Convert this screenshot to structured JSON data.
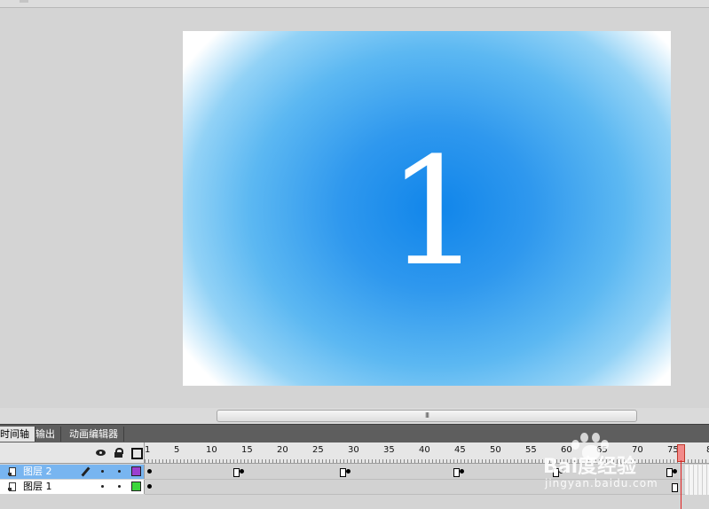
{
  "stage": {
    "content": "1"
  },
  "panel": {
    "tabs": [
      {
        "label": "时间轴",
        "active": true
      },
      {
        "label": "输出",
        "active": false
      },
      {
        "label": "动画编辑器",
        "active": false
      }
    ]
  },
  "timeline": {
    "ruler": [
      "1",
      "5",
      "10",
      "15",
      "20",
      "25",
      "30",
      "35",
      "40",
      "45",
      "50",
      "55",
      "60",
      "65",
      "70",
      "75",
      "8"
    ],
    "current_frame": 75,
    "layers": [
      {
        "name": "图层 2",
        "selected": true,
        "color": "#9b3fd0",
        "keyframes": [
          1,
          14,
          29,
          45,
          59,
          75
        ]
      },
      {
        "name": "图层 1",
        "selected": false,
        "color": "#3cd63c",
        "keyframes": [
          1
        ]
      }
    ]
  },
  "scrollbar": {
    "grip": "III"
  },
  "watermark": {
    "logo": "Bai度经验",
    "site": "jingyan.baidu.com"
  }
}
